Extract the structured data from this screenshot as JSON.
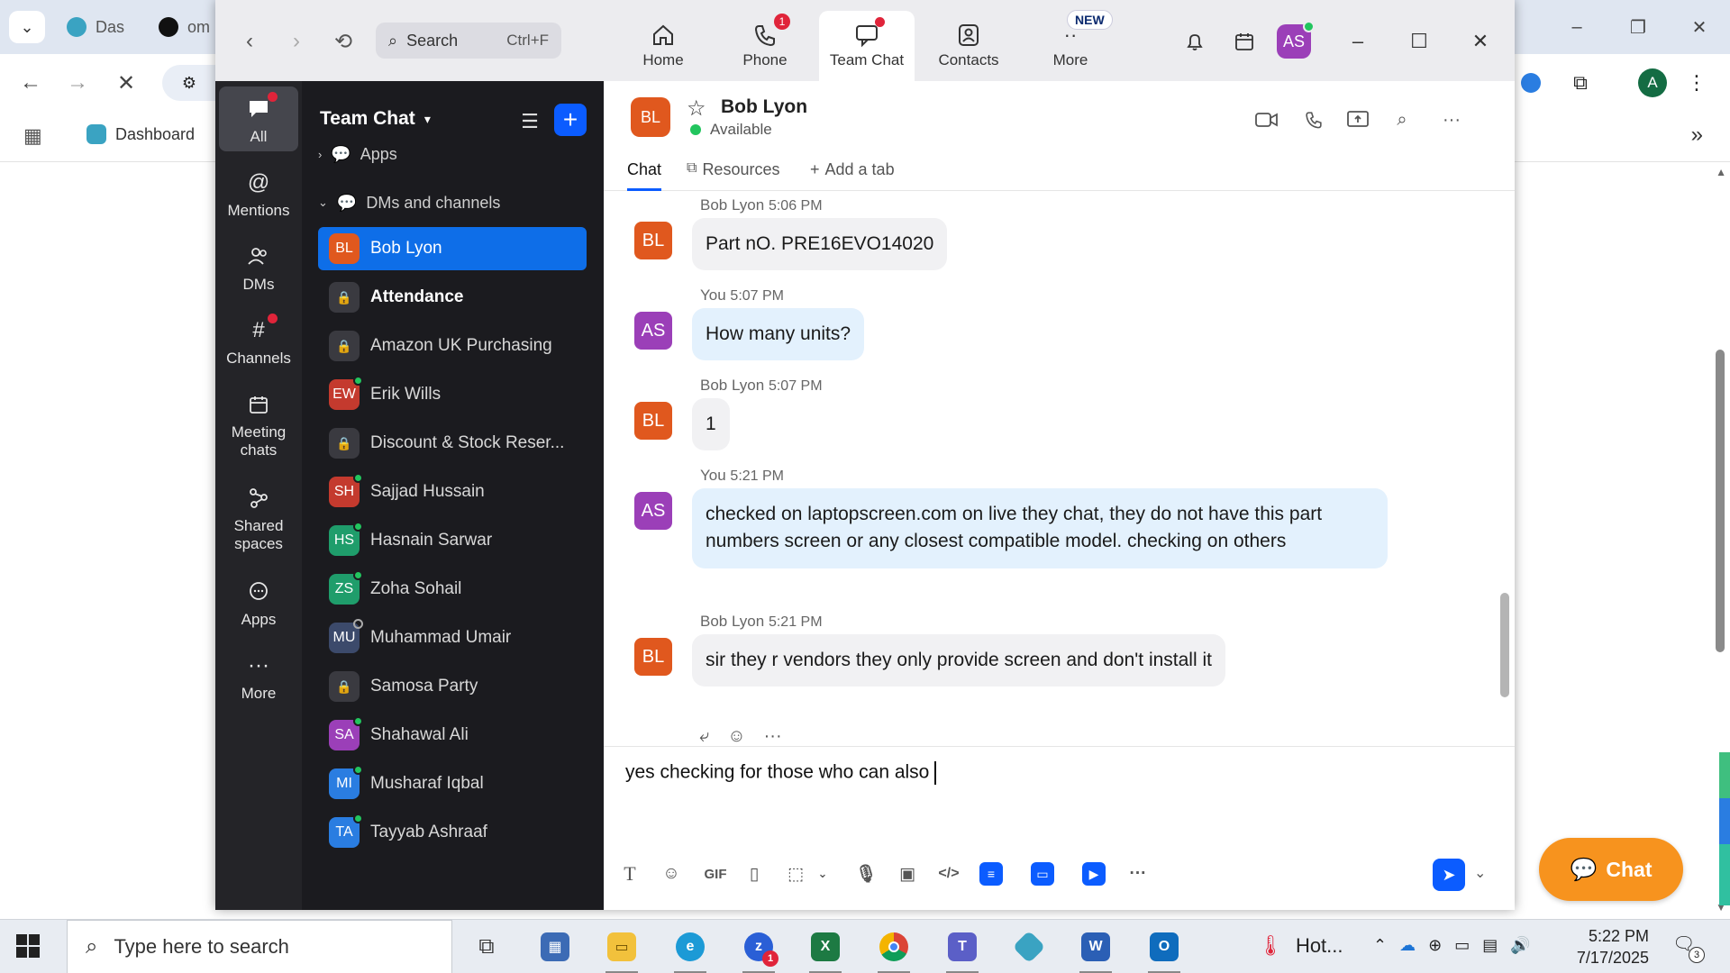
{
  "browser": {
    "tab1_label": "Das",
    "tab2_label": "om",
    "bookmark_label": "Dashboard"
  },
  "zoom": {
    "search_placeholder": "Search",
    "search_shortcut": "Ctrl+F",
    "nav": [
      {
        "label": "Home",
        "icon": "home-icon"
      },
      {
        "label": "Phone",
        "icon": "phone-icon",
        "badge": "1"
      },
      {
        "label": "Team Chat",
        "icon": "team-chat-icon"
      },
      {
        "label": "Contacts",
        "icon": "contacts-icon"
      },
      {
        "label": "More",
        "icon": "more-icon",
        "badge": "NEW"
      }
    ],
    "user_initials": "AS"
  },
  "rail": [
    {
      "label": "All"
    },
    {
      "label": "Mentions"
    },
    {
      "label": "DMs"
    },
    {
      "label": "Channels"
    },
    {
      "label": "Meeting chats"
    },
    {
      "label": "Shared spaces"
    },
    {
      "label": "Apps"
    },
    {
      "label": "More"
    }
  ],
  "channels": {
    "title": "Team Chat",
    "section_apps": "Apps",
    "section_dms": "DMs and channels",
    "items": [
      {
        "name": "Bob Lyon",
        "initials": "BL",
        "color": "#e0581e"
      },
      {
        "name": "Attendance"
      },
      {
        "name": "Amazon UK Purchasing"
      },
      {
        "name": "Erik Wills",
        "initials": "EW",
        "color": "#c43a2e"
      },
      {
        "name": "Discount & Stock Reser..."
      },
      {
        "name": "Sajjad Hussain",
        "initials": "SH",
        "color": "#c43a2e"
      },
      {
        "name": "Hasnain Sarwar",
        "initials": "HS",
        "color": "#1f9d6b"
      },
      {
        "name": "Zoha Sohail",
        "initials": "ZS",
        "color": "#1f9d6b"
      },
      {
        "name": "Muhammad Umair",
        "initials": "MU",
        "color": "#3c4a6b"
      },
      {
        "name": "Samosa Party"
      },
      {
        "name": "Shahawal Ali",
        "initials": "SA",
        "color": "#9b3fb8"
      },
      {
        "name": "Musharaf Iqbal",
        "initials": "MI",
        "color": "#2a7de1"
      },
      {
        "name": "Tayyab Ashraaf",
        "initials": "TA",
        "color": "#2a7de1"
      }
    ]
  },
  "chat": {
    "contact_name": "Bob Lyon",
    "contact_initials": "BL",
    "contact_status": "Available",
    "tabs": [
      "Chat",
      "Resources",
      "Add a tab"
    ],
    "messages": [
      {
        "sender": "Bob Lyon",
        "time": "5:06 PM",
        "initials": "BL",
        "text": "Part nO. PRE16EVO14020"
      },
      {
        "sender": "You",
        "time": "5:07 PM",
        "initials": "AS",
        "text": "How many units?"
      },
      {
        "sender": "Bob Lyon",
        "time": "5:07 PM",
        "initials": "BL",
        "text": "1"
      },
      {
        "sender": "You",
        "time": "5:21 PM",
        "initials": "AS",
        "text": "checked on laptopscreen.com on live they chat, they do not have this part numbers screen or any closest compatible model. checking on others"
      },
      {
        "sender": "Bob Lyon",
        "time": "5:21 PM",
        "initials": "BL",
        "text": "sir they r vendors they only provide screen and don't install it"
      }
    ],
    "compose_text": "yes checking for those who can also"
  },
  "chat_widget_label": "Chat",
  "taskbar": {
    "search_placeholder": "Type here to search",
    "weather": "Hot...",
    "time": "5:22 PM",
    "date": "7/17/2025",
    "notification_count": "3",
    "zoom_badge": "1"
  },
  "colors": {
    "accent": "#0b5cff",
    "selected": "#0e6ee8",
    "bob_avatar": "#e0581e",
    "self_avatar": "#9b3fb8",
    "widget": "#f7931e"
  }
}
